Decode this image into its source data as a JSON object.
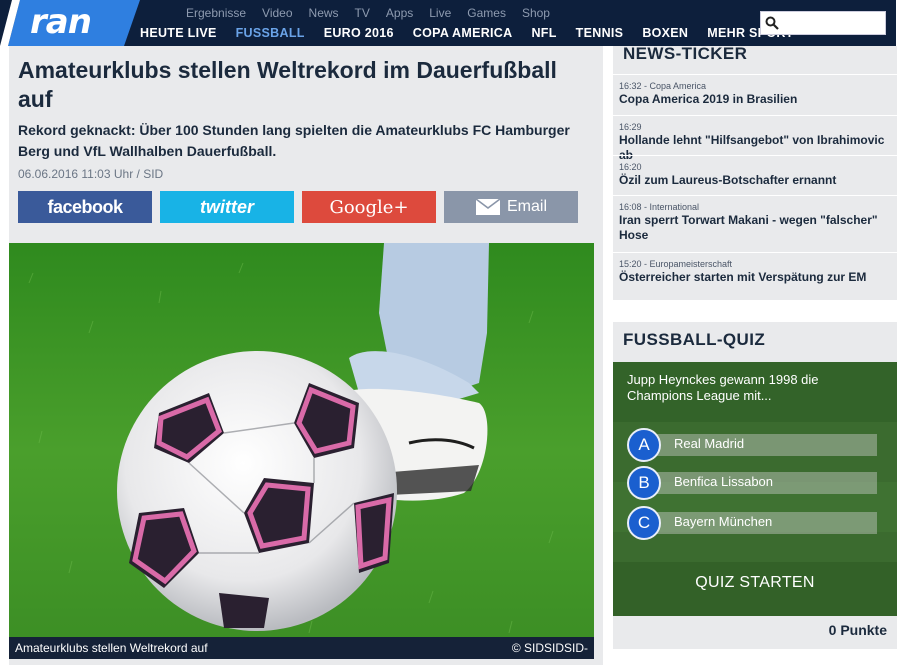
{
  "brand": {
    "logo": "ran",
    "accent": "#6aa3e8",
    "nav_bg": "#0d1f3c"
  },
  "subnav": [
    "Ergebnisse",
    "Video",
    "News",
    "TV",
    "Apps",
    "Live",
    "Games",
    "Shop"
  ],
  "mainnav": [
    "HEUTE LIVE",
    "FUSSBALL",
    "EURO 2016",
    "COPA AMERICA",
    "NFL",
    "TENNIS",
    "BOXEN",
    "MEHR SPORT"
  ],
  "search": {
    "placeholder": "",
    "icon": "search-icon"
  },
  "article": {
    "headline": "Amateurklubs stellen Weltrekord im Dauerfußball auf",
    "teaser": "Rekord geknackt: Über 100 Stunden lang spielten die Amateurklubs FC Hamburger Berg und VfL Wallhalben Dauerfußball.",
    "dateline": "06.06.2016 11:03 Uhr / SID",
    "share": {
      "facebook": "facebook",
      "twitter": "twitter",
      "google": "Google+",
      "email": "Email"
    },
    "caption": "Amateurklubs stellen Weltrekord auf",
    "credit": "© SIDSIDSID-"
  },
  "ticker": {
    "title": "NEWS-TICKER",
    "items": [
      {
        "meta": "16:32 - Copa America",
        "title": "Copa America 2019 in Brasilien"
      },
      {
        "meta": "16:29",
        "title": "Hollande lehnt \"Hilfsangebot\" von Ibrahimovic ab"
      },
      {
        "meta": "16:20",
        "title": "Özil zum Laureus-Botschafter ernannt"
      },
      {
        "meta": "16:08 - International",
        "title": "Iran sperrt Torwart Makani - wegen \"falscher\" Hose"
      },
      {
        "meta": "15:20 - Europameisterschaft",
        "title": "Österreicher starten mit Verspätung zur EM"
      }
    ]
  },
  "quiz": {
    "title": "FUSSBALL-QUIZ",
    "question": "Jupp Heynckes gewann 1998 die Champions League mit...",
    "answers": [
      {
        "letter": "A",
        "label": "Real Madrid"
      },
      {
        "letter": "B",
        "label": "Benfica Lissabon"
      },
      {
        "letter": "C",
        "label": "Bayern München"
      }
    ],
    "start": "QUIZ STARTEN",
    "points": "0 Punkte"
  }
}
